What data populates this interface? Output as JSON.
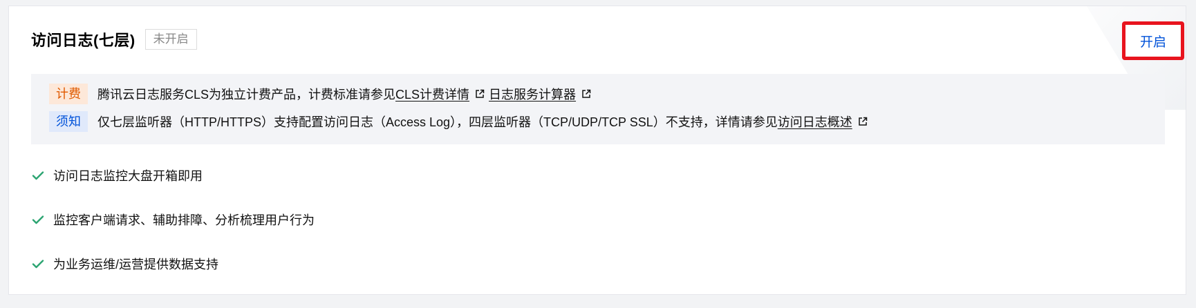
{
  "header": {
    "title": "访问日志(七层)",
    "status": "未开启",
    "enable_button": "开启"
  },
  "notice": {
    "fee": {
      "tag": "计费",
      "text": "腾讯云日志服务CLS为独立计费产品，计费标准请参见",
      "link1": "CLS计费详情",
      "link2": "日志服务计算器"
    },
    "must": {
      "tag": "须知",
      "text": "仅七层监听器（HTTP/HTTPS）支持配置访问日志（Access Log），四层监听器（TCP/UDP/TCP SSL）不支持，详情请参见",
      "link": "访问日志概述"
    }
  },
  "features": [
    "访问日志监控大盘开箱即用",
    "监控客户端请求、辅助排障、分析梳理用户行为",
    "为业务运维/运营提供数据支持"
  ],
  "colors": {
    "accent": "#0052d9",
    "highlight_border": "#e8141e",
    "check": "#2ba471",
    "fee_tag": "#e05a00"
  }
}
